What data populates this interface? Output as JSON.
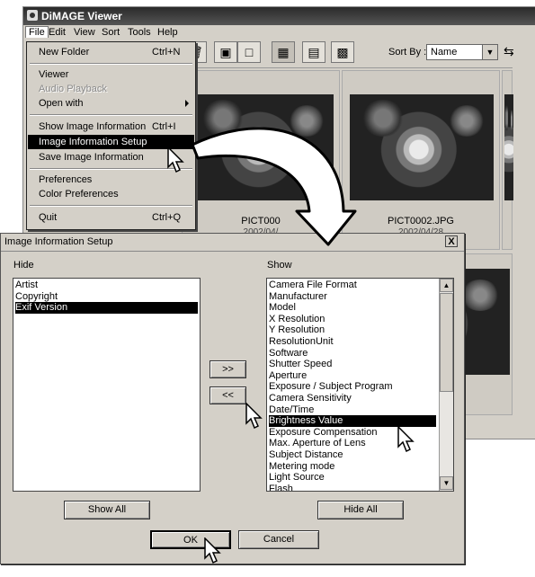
{
  "viewer": {
    "title": "DiMAGE Viewer",
    "menubar": [
      "File",
      "Edit",
      "View",
      "Sort",
      "Tools",
      "Help"
    ],
    "toolbar": {
      "icons": [
        "trash-icon",
        "import-icon",
        "camera-icon",
        "thumbnail-view-icon",
        "list-view-icon",
        "detail-view-icon"
      ],
      "sort_by_label": "Sort By :",
      "sort_by_value": "Name"
    },
    "thumbnails": [
      {
        "label": "PICT000",
        "date": "2002/04/"
      },
      {
        "label": "PICT0002.JPG",
        "date": "2002/04/28"
      },
      {
        "label": "",
        "date": ""
      },
      {
        "label": "PG",
        "date": "8"
      }
    ]
  },
  "file_menu": {
    "items": [
      {
        "label": "New Folder",
        "shortcut": "Ctrl+N"
      },
      {
        "label": "Viewer",
        "shortcut": ""
      },
      {
        "label": "Audio Playback",
        "shortcut": "",
        "disabled": true
      },
      {
        "label": "Open with",
        "shortcut": "",
        "submenu": true
      },
      {
        "label": "Show Image Information",
        "shortcut": "Ctrl+I"
      },
      {
        "label": "Image Information Setup",
        "shortcut": "",
        "highlighted": true
      },
      {
        "label": "Save Image Information",
        "shortcut": ""
      },
      {
        "label": "Preferences",
        "shortcut": ""
      },
      {
        "label": "Color Preferences",
        "shortcut": ""
      },
      {
        "label": "Quit",
        "shortcut": "Ctrl+Q"
      }
    ]
  },
  "dialog": {
    "title": "Image Information Setup",
    "close_label": "X",
    "hide_label": "Hide",
    "show_label": "Show",
    "hide_items": [
      "Artist",
      "Copyright",
      "Exif Version"
    ],
    "hide_selected_index": 2,
    "show_items": [
      "Camera File Format",
      "Manufacturer",
      "Model",
      "X Resolution",
      "Y Resolution",
      "ResolutionUnit",
      "Software",
      "Shutter Speed",
      "Aperture",
      "Exposure / Subject Program",
      "Camera Sensitivity",
      "Date/Time",
      "Brightness Value",
      "Exposure Compensation",
      "Max. Aperture of Lens",
      "Subject Distance",
      "Metering mode",
      "Light Source",
      "Flash"
    ],
    "show_selected_index": 12,
    "move_right_label": ">>",
    "move_left_label": "<<",
    "show_all_label": "Show All",
    "hide_all_label": "Hide All",
    "ok_label": "OK",
    "cancel_label": "Cancel"
  }
}
